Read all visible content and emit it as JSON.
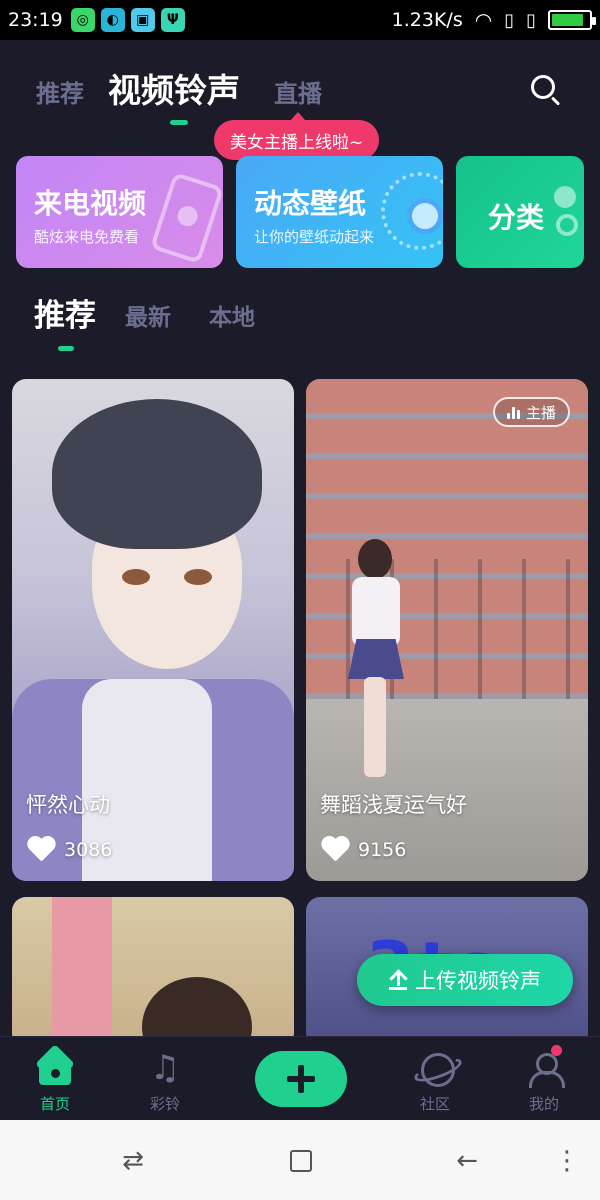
{
  "status_bar": {
    "time": "23:19",
    "network_speed": "1.23K/s",
    "battery_level": 0.85,
    "accent": "#2ecc40"
  },
  "header": {
    "tabs": [
      {
        "label": "推荐",
        "active": false
      },
      {
        "label": "视频铃声",
        "active": true
      },
      {
        "label": "直播",
        "active": false
      }
    ],
    "search_icon": "search-icon",
    "live_bubble": "美女主播上线啦~"
  },
  "features": [
    {
      "title": "来电视频",
      "subtitle": "酷炫来电免费看",
      "color": "#c286f6"
    },
    {
      "title": "动态壁纸",
      "subtitle": "让你的壁纸动起来",
      "color": "#4aa8f6"
    },
    {
      "title": "分类",
      "subtitle": "",
      "color": "#14c28a"
    }
  ],
  "sub_tabs": [
    {
      "label": "推荐",
      "active": true
    },
    {
      "label": "最新",
      "active": false
    },
    {
      "label": "本地",
      "active": false
    }
  ],
  "videos": [
    {
      "title": "怦然心动",
      "likes": "3086"
    },
    {
      "title": "舞蹈浅夏运气好",
      "likes": "9156",
      "tag": "主播"
    },
    {
      "title": "",
      "likes": ""
    },
    {
      "title": "",
      "likes": ""
    }
  ],
  "upload_button": "上传视频铃声",
  "bottom_nav": [
    {
      "label": "首页",
      "icon": "home-icon",
      "active": true
    },
    {
      "label": "彩铃",
      "icon": "music-note-icon",
      "active": false
    },
    {
      "label": "",
      "icon": "add-icon",
      "active": false
    },
    {
      "label": "社区",
      "icon": "planet-icon",
      "active": false
    },
    {
      "label": "我的",
      "icon": "user-icon",
      "active": false,
      "badge": true
    }
  ],
  "colors": {
    "accent": "#1fd08e",
    "bubble": "#f0396b",
    "inactive": "#6b6f8f",
    "background": "#1c1b2a"
  }
}
